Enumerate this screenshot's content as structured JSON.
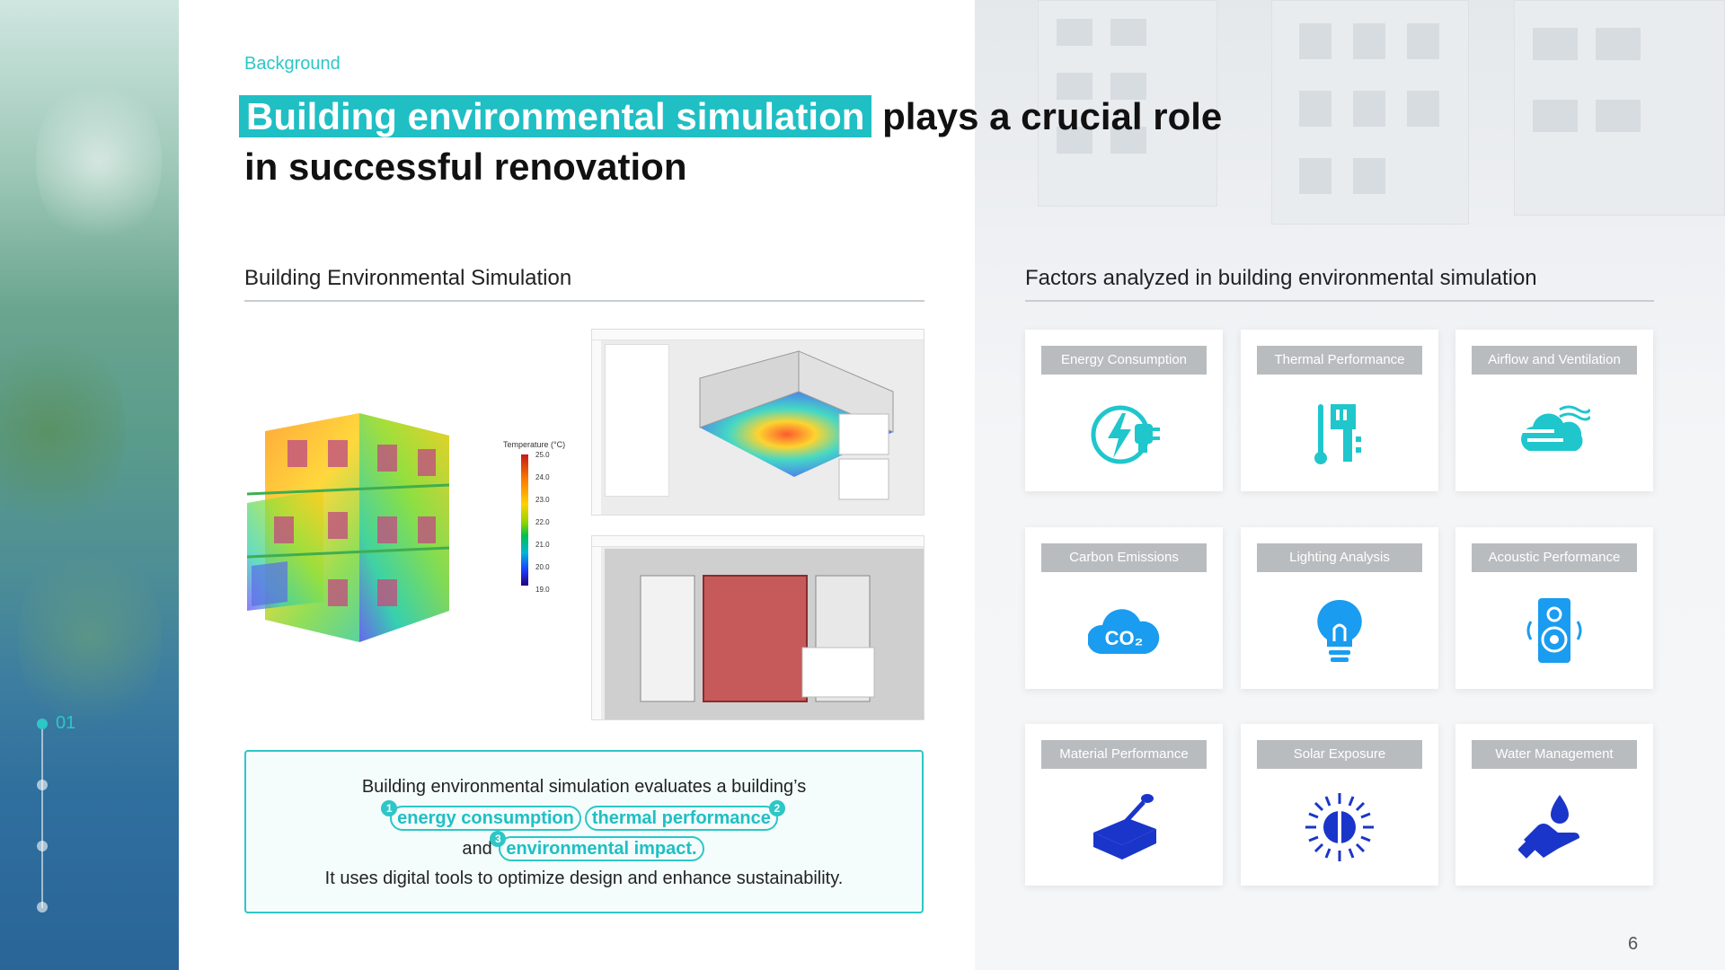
{
  "eyebrow": "Background",
  "headline": {
    "highlight": "Building environmental simulation",
    "rest_line1": "plays a crucial role",
    "line2": "in successful renovation"
  },
  "left_section": {
    "title": "Building Environmental Simulation"
  },
  "legend": {
    "title": "Temperature (°C)",
    "ticks": [
      "25.0",
      "24.0",
      "23.0",
      "22.0",
      "21.0",
      "20.0",
      "19.0"
    ]
  },
  "info_box": {
    "line1": "Building environmental simulation evaluates a building’s",
    "pill1": "energy consumption",
    "pill2": "thermal performance",
    "and_word": "and",
    "pill3": "environmental impact",
    "period": ".",
    "line4": "It uses digital tools to optimize design and enhance sustainability.",
    "badge1": "1",
    "badge2": "2",
    "badge3": "3"
  },
  "stepper": {
    "active_label": "01"
  },
  "right_section": {
    "title": "Factors analyzed in building environmental simulation",
    "factors": [
      {
        "label": "Energy Consumption",
        "icon": "energy-plug-icon",
        "color": "#1fc6cc"
      },
      {
        "label": "Thermal Performance",
        "icon": "thermometer-icon",
        "color": "#1fc6cc"
      },
      {
        "label": "Airflow and Ventilation",
        "icon": "airflow-cloud-icon",
        "color": "#1fc6cc"
      },
      {
        "label": "Carbon Emissions",
        "icon": "co2-cloud-icon",
        "color": "#1a9cf0"
      },
      {
        "label": "Lighting Analysis",
        "icon": "lightbulb-icon",
        "color": "#1a9cf0"
      },
      {
        "label": "Acoustic Performance",
        "icon": "speaker-icon",
        "color": "#1a9cf0"
      },
      {
        "label": "Material Performance",
        "icon": "trowel-brick-icon",
        "color": "#1a35c9"
      },
      {
        "label": "Solar Exposure",
        "icon": "sun-icon",
        "color": "#1a35c9"
      },
      {
        "label": "Water Management",
        "icon": "water-hand-icon",
        "color": "#1a35c9"
      }
    ]
  },
  "page_number": "6",
  "colors": {
    "accent": "#2ec6c6",
    "chip": "#b9bcbf"
  }
}
